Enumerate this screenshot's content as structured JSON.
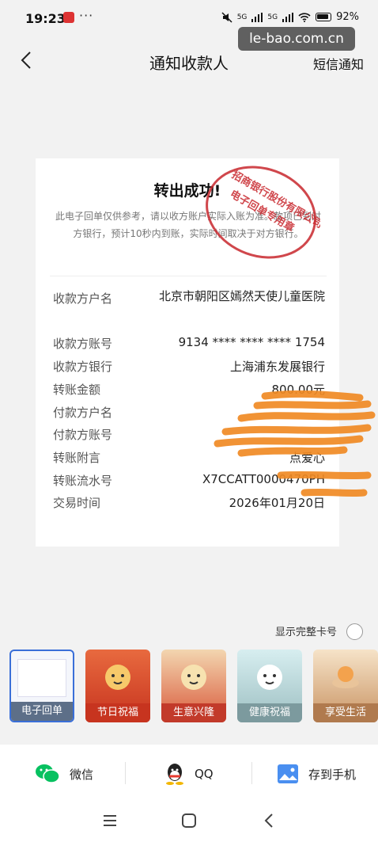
{
  "status_bar": {
    "time": "19:23",
    "more": "···",
    "signal1": "5G",
    "signal2": "5G",
    "battery": "92%"
  },
  "watermark": "le-bao.com.cn",
  "header": {
    "title": "通知收款人",
    "sms_label": "短信通知"
  },
  "receipt": {
    "title": "转出成功!",
    "notice": "此电子回单仅供参考，请以收方账户实际入账为准。款项已到对方银行，预计10秒内到账，实际时间取决于对方银行。",
    "stamp_text": "招商银行股份有限公司电子回单专用章",
    "rows": [
      {
        "label": "收款方户名",
        "value": "北京市朝阳区嫣然天使儿童医院"
      },
      {
        "label": "收款方账号",
        "value": "9134 **** **** **** 1754"
      },
      {
        "label": "收款方银行",
        "value": "上海浦东发展银行"
      },
      {
        "label": "转账金额",
        "value": "800.00元"
      },
      {
        "label": "付款方户名",
        "value": ""
      },
      {
        "label": "付款方账号",
        "value": ""
      },
      {
        "label": "转账附言",
        "value": "点爱心"
      },
      {
        "label": "转账流水号",
        "value": "X7CCATT0000470PH"
      },
      {
        "label": "交易时间",
        "value": "2026年01月20日"
      }
    ]
  },
  "show_full_card": "显示完整卡号",
  "templates": [
    {
      "label": "电子回单",
      "color": "#5d6f88"
    },
    {
      "label": "节日祝福",
      "color": "#d7462f"
    },
    {
      "label": "生意兴隆",
      "color": "#c23a2a"
    },
    {
      "label": "健康祝福",
      "color": "#7c9a9e"
    },
    {
      "label": "享受生活",
      "color": "#b07a4e"
    }
  ],
  "share": {
    "wechat": "微信",
    "qq": "QQ",
    "save": "存到手机"
  },
  "colors": {
    "accent": "#3a6fd8",
    "stamp": "#c8272d",
    "scribble": "#f08a24",
    "wechat": "#07c160"
  }
}
